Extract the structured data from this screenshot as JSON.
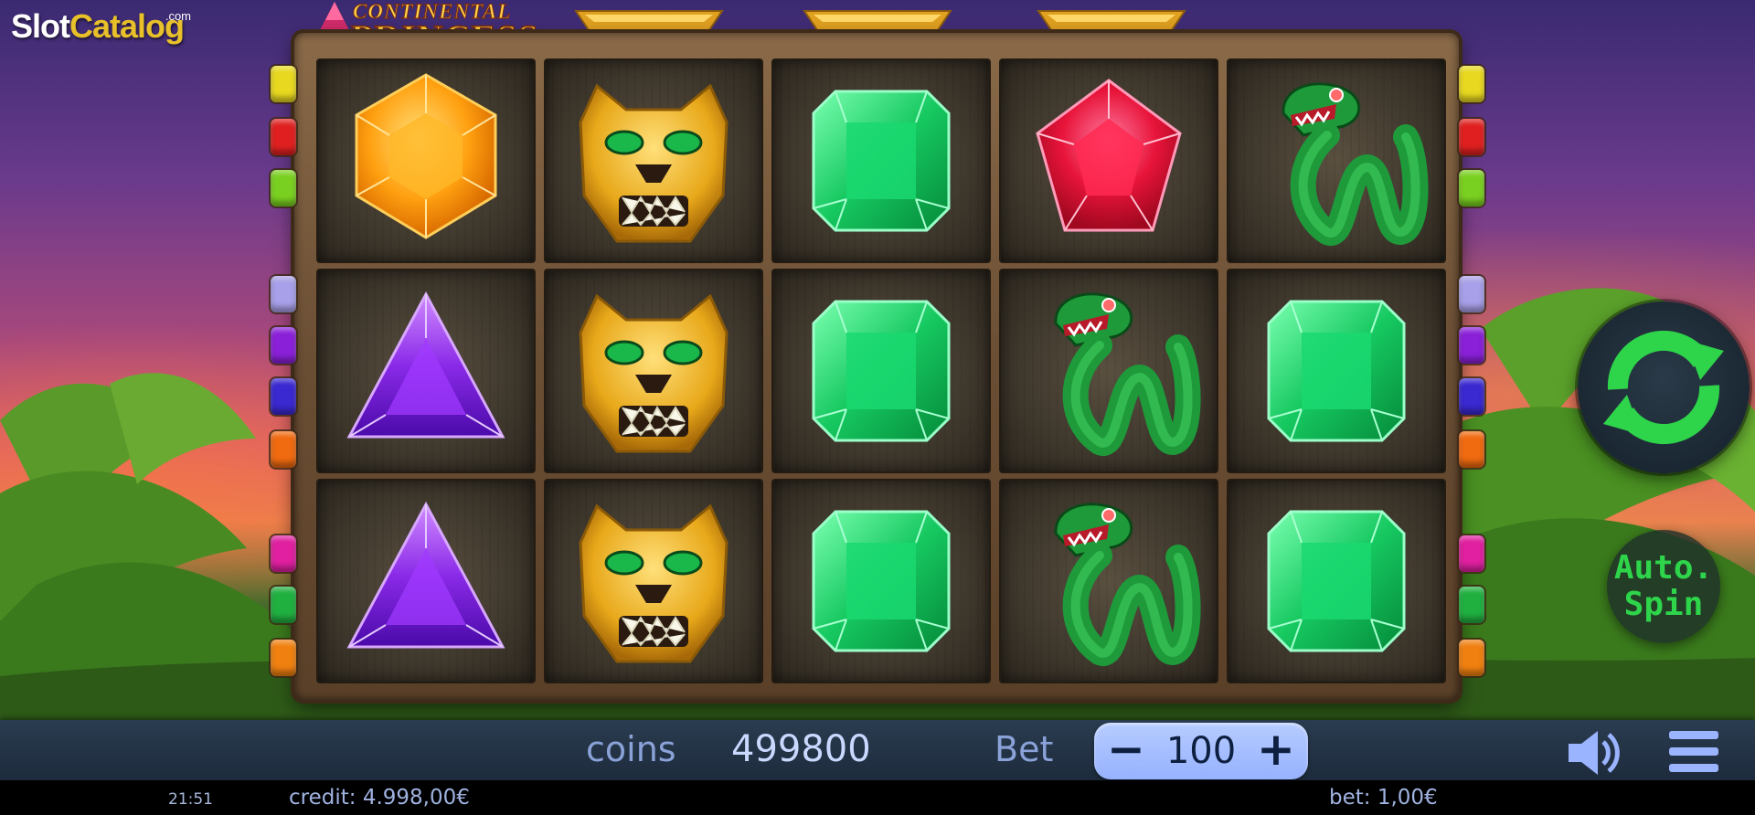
{
  "branding": {
    "watermark_main": "Slot",
    "watermark_accent": "Catalog",
    "watermark_suffix": ".com",
    "game_title_line1": "CONTINENTAL",
    "game_title_line2": "PRINCESS"
  },
  "reels": {
    "rows": [
      [
        "orange-hexagon-gem",
        "golden-jaguar",
        "green-emerald",
        "red-pentagon-gem",
        "green-serpent"
      ],
      [
        "purple-triangle-gem",
        "golden-jaguar",
        "green-emerald",
        "green-serpent",
        "green-emerald"
      ],
      [
        "purple-triangle-gem",
        "golden-jaguar",
        "green-emerald",
        "green-serpent",
        "green-emerald"
      ]
    ]
  },
  "paylines": {
    "left_colors": [
      "#e8d820",
      "#e02020",
      "#7ad020",
      "#a8a0e8",
      "#8a20d8",
      "#3a28d0",
      "#f06a10",
      "#e020a0",
      "#20b040",
      "#f08010"
    ],
    "right_colors": [
      "#e8d820",
      "#e02020",
      "#7ad020",
      "#a8a0e8",
      "#8a20d8",
      "#3a28d0",
      "#f06a10",
      "#e020a0",
      "#20b040",
      "#f08010"
    ]
  },
  "controls": {
    "spin_icon": "refresh-icon",
    "auto_spin_line1": "Auto.",
    "auto_spin_line2": "Spin",
    "sound_icon": "speaker-icon",
    "menu_icon": "hamburger-menu-icon",
    "bet_minus": "−",
    "bet_plus": "+"
  },
  "bottom_bar": {
    "coins_label": "coins",
    "coins_value": "499800",
    "bet_label": "Bet",
    "bet_value": "100"
  },
  "status_bar": {
    "time": "21:51",
    "credit": "credit: 4.998,00€",
    "bet": "bet: 1,00€"
  },
  "colors": {
    "accent_green": "#2ed44a",
    "bar_label": "#8aa2d8",
    "bet_pill": "#9fb8ff"
  }
}
